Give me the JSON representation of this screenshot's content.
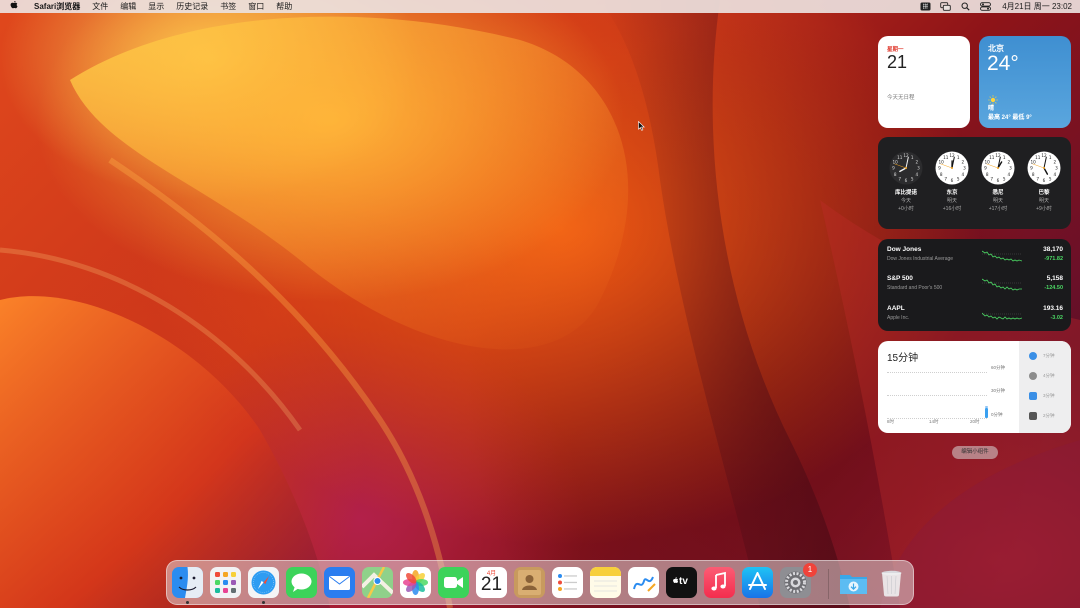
{
  "menubar": {
    "app_name": "Safari浏览器",
    "items": [
      "文件",
      "编辑",
      "显示",
      "历史记录",
      "书签",
      "窗口",
      "帮助"
    ],
    "clock": "4月21日 周一  23:02",
    "status_icons": [
      "input-method-icon",
      "screen-mirroring-icon",
      "search-icon",
      "control-center-icon"
    ]
  },
  "widgets": {
    "calendar": {
      "weekday": "星期一",
      "day": "21",
      "empty_text": "今天无日程"
    },
    "weather": {
      "city": "北京",
      "temp": "24°",
      "condition": "晴",
      "range": "最高 24° 最低 9°",
      "icon": "sun-icon"
    },
    "clocks": [
      {
        "city": "库比提诺",
        "day": "今天",
        "offset": "+0小时",
        "hour": 8,
        "minute": 2,
        "dark": true
      },
      {
        "city": "东京",
        "day": "明天",
        "offset": "+16小时",
        "hour": 0,
        "minute": 2,
        "dark": false
      },
      {
        "city": "悉尼",
        "day": "明天",
        "offset": "+17小时",
        "hour": 1,
        "minute": 2,
        "dark": false
      },
      {
        "city": "巴黎",
        "day": "明天",
        "offset": "+9小时",
        "hour": 5,
        "minute": 2,
        "dark": false
      }
    ],
    "stocks": [
      {
        "symbol": "Dow Jones",
        "name": "Dow Jones Industrial Average",
        "price": "38,170",
        "change": "-971.82"
      },
      {
        "symbol": "S&P 500",
        "name": "Standard and Poor's 500",
        "price": "5,158",
        "change": "-124.50"
      },
      {
        "symbol": "AAPL",
        "name": "Apple Inc.",
        "price": "193.16",
        "change": "-3.02"
      }
    ],
    "screen_time": {
      "total": "15分钟",
      "y_labels": [
        "60分钟",
        "30分钟",
        "0分钟"
      ],
      "x_labels": [
        "8时",
        "14时",
        "20时"
      ],
      "apps": [
        {
          "time": "7分钟",
          "color": "#3a8fe6"
        },
        {
          "time": "4分钟",
          "color": "#8c8c8c"
        },
        {
          "time": "3分钟",
          "color": "#3a8fe6"
        },
        {
          "time": "2分钟",
          "color": "#555555"
        }
      ]
    },
    "edit_button": "编辑小组件"
  },
  "dock": {
    "apps": [
      {
        "name": "finder",
        "running": true
      },
      {
        "name": "launchpad",
        "running": false
      },
      {
        "name": "safari",
        "running": true
      },
      {
        "name": "messages",
        "running": false
      },
      {
        "name": "mail",
        "running": false
      },
      {
        "name": "maps",
        "running": false
      },
      {
        "name": "photos",
        "running": false
      },
      {
        "name": "facetime",
        "running": false
      },
      {
        "name": "calendar",
        "running": false,
        "month": "4月",
        "day": "21"
      },
      {
        "name": "contacts",
        "running": false
      },
      {
        "name": "reminders",
        "running": false
      },
      {
        "name": "notes",
        "running": false
      },
      {
        "name": "freeform",
        "running": false
      },
      {
        "name": "apple-tv",
        "running": false,
        "label": "tv"
      },
      {
        "name": "music",
        "running": false
      },
      {
        "name": "app-store",
        "running": false
      },
      {
        "name": "system-settings",
        "running": false,
        "badge": "1"
      },
      {
        "name": "downloads-folder",
        "running": false
      },
      {
        "name": "trash",
        "running": false
      }
    ]
  }
}
